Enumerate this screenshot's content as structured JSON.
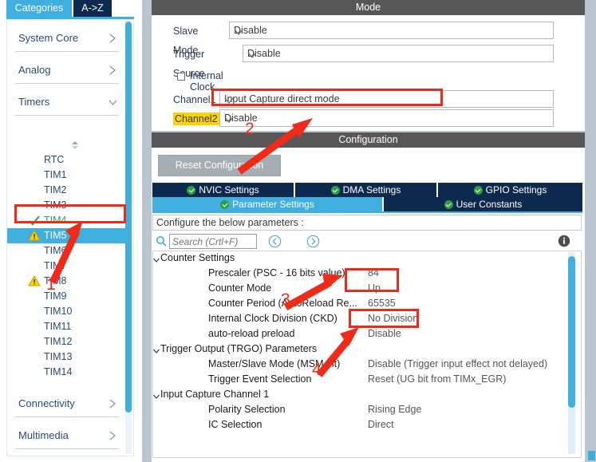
{
  "sidebar": {
    "tabs": [
      {
        "id": "categories",
        "label": "Categories",
        "active": true
      },
      {
        "id": "a-to-z",
        "label": "A->Z",
        "active": false
      }
    ],
    "categories": [
      {
        "id": "system-core",
        "label": "System Core",
        "expanded": false,
        "chevron": "chevron-right-icon"
      },
      {
        "id": "analog",
        "label": "Analog",
        "expanded": false,
        "chevron": "chevron-right-icon"
      },
      {
        "id": "timers",
        "label": "Timers",
        "expanded": true,
        "chevron": "chevron-down-icon"
      }
    ],
    "timers": [
      {
        "label": "RTC",
        "state": "none",
        "selected": false
      },
      {
        "label": "TIM1",
        "state": "none",
        "selected": false
      },
      {
        "label": "TIM2",
        "state": "none",
        "selected": false
      },
      {
        "label": "TIM3",
        "state": "none",
        "selected": false
      },
      {
        "label": "TIM4",
        "state": "ok",
        "selected": false
      },
      {
        "label": "TIM5",
        "state": "warning",
        "selected": true
      },
      {
        "label": "TIM6",
        "state": "none",
        "selected": false
      },
      {
        "label": "TIM7",
        "state": "none",
        "selected": false
      },
      {
        "label": "TIM8",
        "state": "warning",
        "selected": false
      },
      {
        "label": "TIM9",
        "state": "none",
        "selected": false
      },
      {
        "label": "TIM10",
        "state": "none",
        "selected": false
      },
      {
        "label": "TIM11",
        "state": "none",
        "selected": false
      },
      {
        "label": "TIM12",
        "state": "none",
        "selected": false
      },
      {
        "label": "TIM13",
        "state": "none",
        "selected": false
      },
      {
        "label": "TIM14",
        "state": "none",
        "selected": false
      }
    ],
    "bottom_categories": [
      {
        "id": "connectivity",
        "label": "Connectivity",
        "chevron": "chevron-right-icon"
      },
      {
        "id": "multimedia",
        "label": "Multimedia",
        "chevron": "chevron-right-icon"
      }
    ]
  },
  "mode": {
    "title": "Mode",
    "rows": [
      {
        "id": "slave-mode",
        "label": "Slave Mode",
        "value": "Disable",
        "type": "dropdown"
      },
      {
        "id": "trigger-source",
        "label": "Trigger Source",
        "value": "Disable",
        "type": "dropdown"
      },
      {
        "id": "internal-clock",
        "label": "Internal Clock",
        "value": "",
        "type": "checkbox",
        "checked": false
      },
      {
        "id": "channel1",
        "label": "Channel1",
        "value": "Input Capture direct mode",
        "type": "dropdown",
        "highlighted_value": true
      },
      {
        "id": "channel2",
        "label": "Channel2",
        "value": "Disable",
        "type": "dropdown",
        "highlighted_label": true
      }
    ]
  },
  "configuration": {
    "title": "Configuration",
    "reset_button": "Reset Configuration",
    "tabs_top": [
      {
        "id": "nvic-settings",
        "label": "NVIC Settings",
        "active": false
      },
      {
        "id": "dma-settings",
        "label": "DMA Settings",
        "active": false
      },
      {
        "id": "gpio-settings",
        "label": "GPIO Settings",
        "active": false
      }
    ],
    "tabs_bottom": [
      {
        "id": "parameter-settings",
        "label": "Parameter Settings",
        "active": true
      },
      {
        "id": "user-constants",
        "label": "User Constants",
        "active": false
      }
    ],
    "configure_hint": "Configure the below parameters :",
    "search_placeholder": "Search (Crtl+F)",
    "nav_prev_icon": "chevron-left-circle-icon",
    "nav_next_icon": "chevron-right-circle-icon",
    "info_icon": "info-icon",
    "tree": [
      {
        "kind": "group",
        "label": "Counter Settings",
        "expanded": true
      },
      {
        "kind": "param",
        "label": "Prescaler (PSC - 16 bits value)",
        "value": "84"
      },
      {
        "kind": "param",
        "label": "Counter Mode",
        "value": "Up"
      },
      {
        "kind": "param",
        "label": "Counter Period (AutoReload Re...",
        "value": "65535"
      },
      {
        "kind": "param",
        "label": "Internal Clock Division (CKD)",
        "value": "No Division"
      },
      {
        "kind": "param",
        "label": "auto-reload preload",
        "value": "Disable"
      },
      {
        "kind": "group",
        "label": "Trigger Output (TRGO) Parameters",
        "expanded": true
      },
      {
        "kind": "param",
        "label": "Master/Slave Mode (MSM bit)",
        "value": "Disable (Trigger input effect not delayed)"
      },
      {
        "kind": "param",
        "label": "Trigger Event Selection",
        "value": "Reset (UG bit from TIMx_EGR)"
      },
      {
        "kind": "group",
        "label": "Input Capture Channel 1",
        "expanded": true
      },
      {
        "kind": "param",
        "label": "Polarity Selection",
        "value": "Rising Edge"
      },
      {
        "kind": "param",
        "label": "IC Selection",
        "value": "Direct"
      }
    ]
  },
  "annotations": {
    "color": "#ee2b19",
    "markers": [
      {
        "id": "marker-1",
        "label": "1",
        "target": "sidebar-timer-tim5"
      },
      {
        "id": "marker-2",
        "label": "2",
        "target": "mode-channel1-value"
      },
      {
        "id": "marker-3",
        "label": "3",
        "target": "prescaler-value"
      },
      {
        "id": "marker-4",
        "label": "4",
        "target": "counter-period-value"
      }
    ]
  },
  "colors": {
    "accent_blue": "#3fafe0",
    "tab_dark": "#0d2a4e",
    "panel_header": "#575757",
    "app_background": "#b9c5cf",
    "warning_yellow": "#ffd200",
    "ok_green": "#2e9e3f",
    "annotation_red": "#ee2b19"
  }
}
